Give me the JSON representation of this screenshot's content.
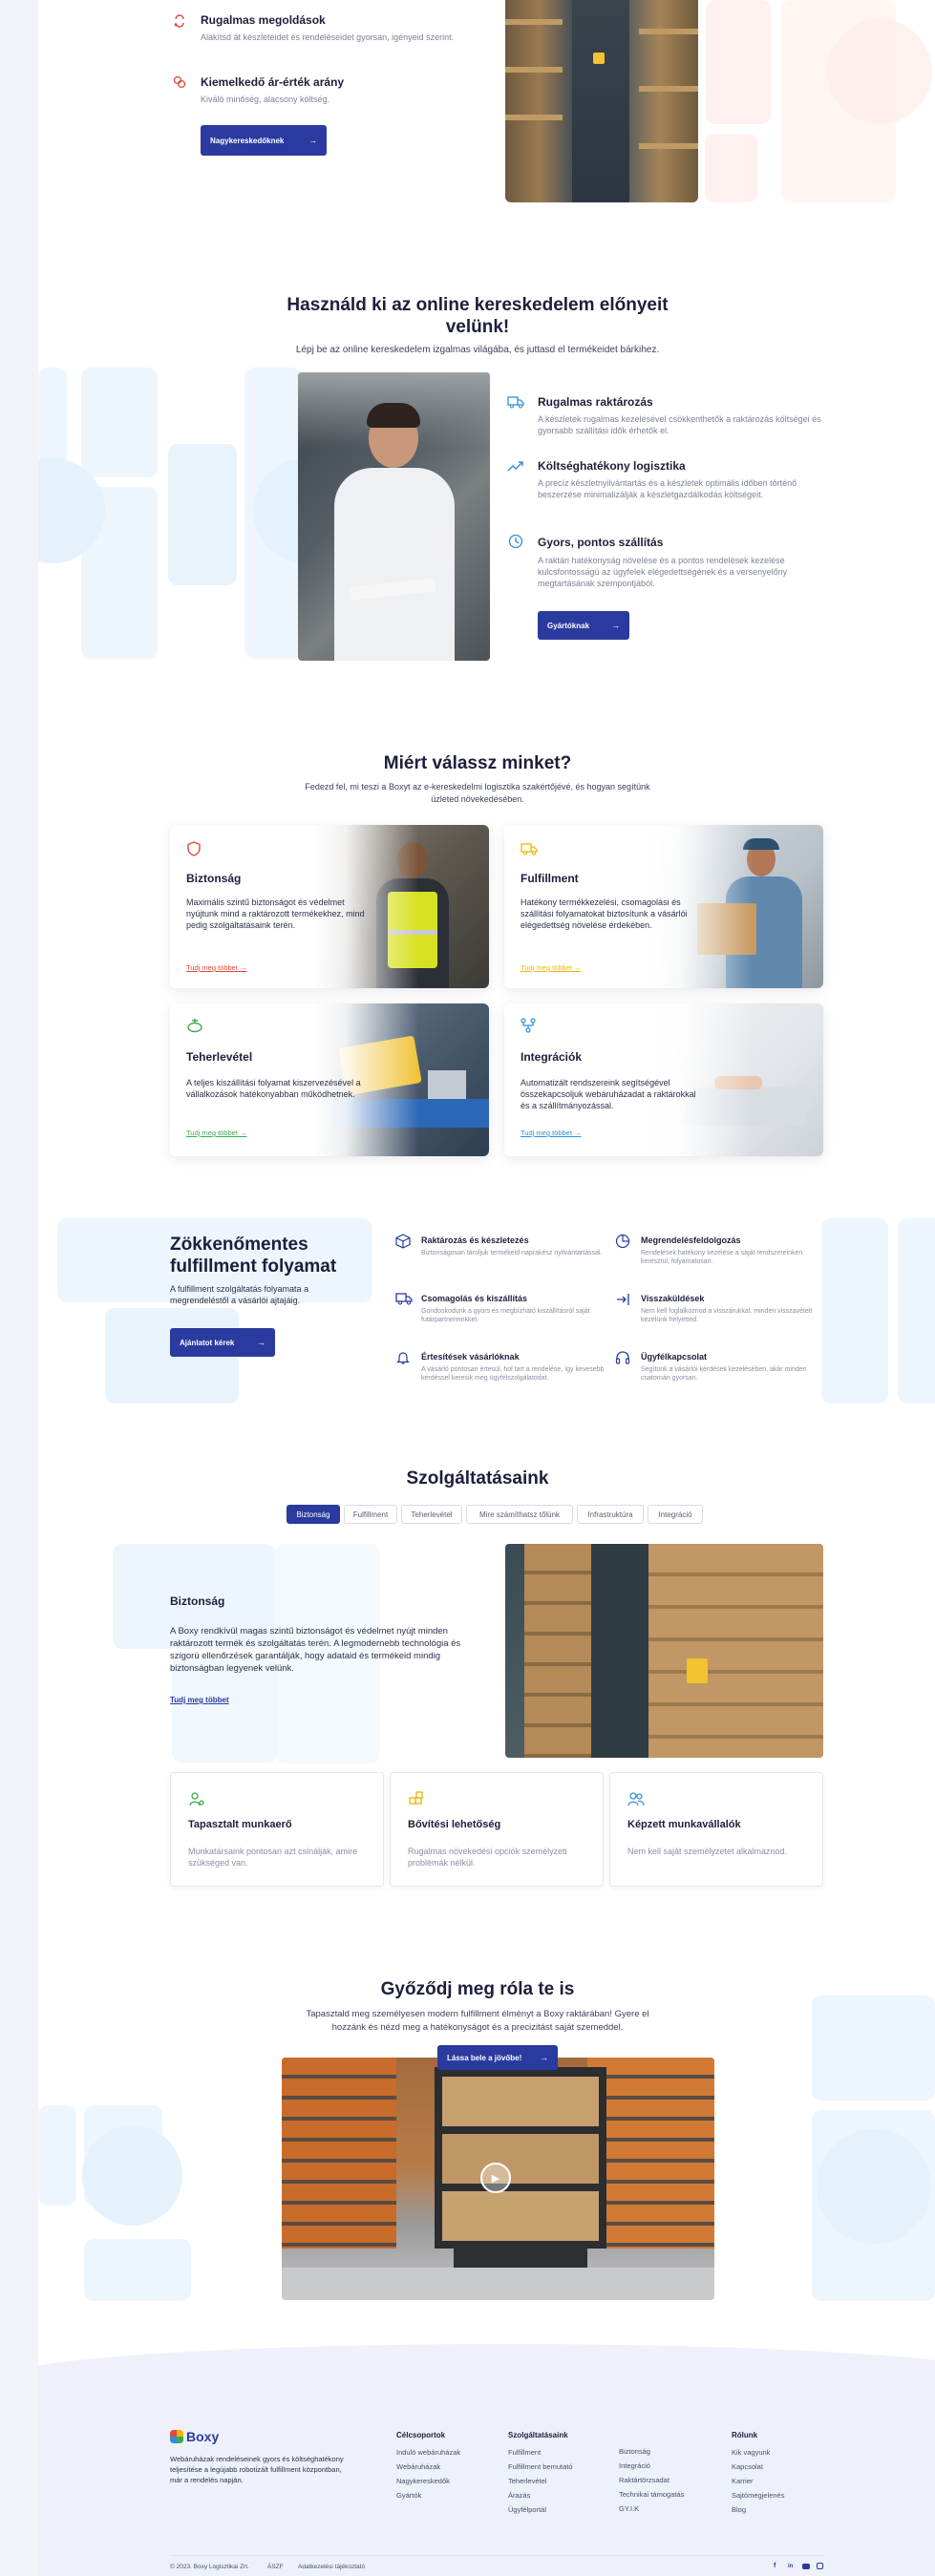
{
  "colors": {
    "brand": "#2a3a9e",
    "accent_red": "#e0473a",
    "accent_blue": "#2f8fd6",
    "accent_yellow": "#f4b400",
    "accent_green": "#3cab4a"
  },
  "top_features": [
    {
      "title": "Rugalmas megoldások",
      "desc": "Alakítsd át készleteidet és rendeléseidet gyorsan, igényeid szerint.",
      "icon": "cycle-icon"
    },
    {
      "title": "Kiemelkedő ár-érték arány",
      "desc": "Kiváló minőség, alacsony költség.",
      "icon": "coins-icon"
    }
  ],
  "top_button": "Nagykereskedőknek",
  "online": {
    "title_line1": "Használd ki az online kereskedelem előnyeit",
    "title_line2": "velünk!",
    "subtitle": "Lépj be az online kereskedelem izgalmas világába, és juttasd el termékeidet bárkihez.",
    "features": [
      {
        "title": "Rugalmas raktározás",
        "desc": "A készletek rugalmas kezelésével csökkenthetők a raktározás költségei és gyorsabb szállítási idők érhetők el.",
        "icon": "truck-icon"
      },
      {
        "title": "Költséghatékony logisztika",
        "desc": "A precíz készletnyilvántartás és a készletek optimális időben történő beszerzése minimalizálják a készletgazdálkodás költségeit.",
        "icon": "trend-up-icon"
      },
      {
        "title": "Gyors, pontos szállítás",
        "desc": "A raktári hatékonyság növelése és a pontos rendelések kezelése kulcsfontosságú az ügyfelek elégedettségének és a versenyelőny megtartásának szempontjából.",
        "icon": "clock-icon"
      }
    ],
    "button": "Gyártóknak"
  },
  "why": {
    "title": "Miért válassz minket?",
    "subtitle_line1": "Fedezd fel, mi teszi a Boxyt az e-kereskedelmi logisztika szakértőjévé, és hogyan segítünk",
    "subtitle_line2": "üzleted növekedésében.",
    "cards": [
      {
        "title": "Biztonság",
        "text": "Maximális szintű biztonságot és védelmet nyújtunk mind a raktározott termékekhez, mind pedig szolgáltatásaink terén.",
        "link": "Tudj meg többet",
        "icon": "shield-icon",
        "color": "#e0473a"
      },
      {
        "title": "Fulfillment",
        "text": "Hatékony termékkezelési, csomagolási és szállítási folyamatokat biztosítunk a vásárlói elégedettség növelése érdekében.",
        "link": "Tudj meg többet",
        "icon": "truck-icon",
        "color": "#f4b400"
      },
      {
        "title": "Teherlevétel",
        "text": "A teljes kiszállítási folyamat kiszervezésével a vállalkozások hatékonyabban működhetnek.",
        "link": "Tudj meg többet",
        "icon": "robot-icon",
        "color": "#3cab4a"
      },
      {
        "title": "Integrációk",
        "text": "Automatizált rendszereink segítségével összekapcsoljuk webáruházadat a raktárokkal és a szállítmányozással.",
        "link": "Tudj meg többet",
        "icon": "nodes-icon",
        "color": "#2f8fd6"
      }
    ]
  },
  "process": {
    "title_line1": "Zökkenőmentes",
    "title_line2": "fulfillment folyamat",
    "desc": "A fulfillment szolgáltatás folyamata a megrendeléstől a vásárlói ajtajáig.",
    "button": "Ajánlatot kérek",
    "items": [
      {
        "title": "Raktározás és készletezés",
        "desc": "Biztonságosan tároljuk termékeid naprakész nyilvántartással.",
        "icon": "box-icon"
      },
      {
        "title": "Megrendelésfeldolgozás",
        "desc": "Rendelések hatékony kezelése a saját rendszereinken keresztül, folyamatosan.",
        "icon": "pie-icon"
      },
      {
        "title": "Csomagolás és kiszállítás",
        "desc": "Gondoskodunk a gyors és megbízható kiszállításról saját futárpartnereinkkel.",
        "icon": "truck-icon"
      },
      {
        "title": "Visszaküldések",
        "desc": "Nem kell foglalkoznod a visszárukkal, minden visszavételt kezelünk helyetted.",
        "icon": "return-icon"
      },
      {
        "title": "Értesítések vásárlóknak",
        "desc": "A vásárló pontosan értesül, hol tart a rendelése, így kevesebb kérdéssel keresik meg ügyfélszolgálatodat.",
        "icon": "bell-icon"
      },
      {
        "title": "Ügyfélkapcsolat",
        "desc": "Segítünk a vásárlói kérdések kezelésében, akár minden csatornán gyorsan.",
        "icon": "headset-icon"
      }
    ]
  },
  "services": {
    "title": "Szolgáltatásaink",
    "tabs": [
      "Biztonság",
      "Fulfillment",
      "Teherlevétel",
      "Mire számíthatsz tőlünk",
      "Infrastruktúra",
      "Integráció"
    ],
    "active_tab": "Biztonság",
    "panel_title": "Biztonság",
    "panel_text": "A Boxy rendkívül magas szintű biztonságot és védelmet nyújt minden raktározott termék és szolgáltatás terén. A legmodernebb technológia és szigorú ellenőrzések garantálják, hogy adataid és termékeid mindig biztonságban legyenek velünk.",
    "panel_link": "Tudj meg többet",
    "minis": [
      {
        "title": "Tapasztalt munkaerő",
        "desc": "Munkatársaink pontosan azt csinálják, amire szükséged van.",
        "icon": "user-gear-icon",
        "color": "#3cab4a"
      },
      {
        "title": "Bővítési lehetőség",
        "desc": "Rugalmas növekedési opciók személyzeti problémák nélkül.",
        "icon": "blocks-icon",
        "color": "#f4b400"
      },
      {
        "title": "Képzett munkavállalók",
        "desc": "Nem kell saját személyzetet alkalmaznod.",
        "icon": "users-icon",
        "color": "#2f8fd6"
      }
    ]
  },
  "video": {
    "title": "Győződj meg róla te is",
    "subtitle_line1": "Tapasztald meg személyesen modern fulfillment élményt a Boxy raktárában! Gyere el",
    "subtitle_line2": "hozzánk és nézd meg a hatékonyságot és a precizitást saját szemeddel.",
    "button": "Lássa bele a jövőbe!"
  },
  "footer": {
    "logo": "Boxy",
    "about": "Webáruházak rendeléseinek gyors és költséghatékony teljesítése a legújabb robotizált fulfillment központban, már a rendelés napján.",
    "columns": [
      {
        "heading": "Célcsoportok",
        "links": [
          "Induló webáruházak",
          "Webáruházak",
          "Nagykereskedők",
          "Gyártók"
        ]
      },
      {
        "heading": "Szolgáltatásaink",
        "links": [
          "Fulfillment",
          "Fulfillment bemutató",
          "Teherlevétel",
          "Árazás",
          "Ügyfélportál"
        ]
      },
      {
        "heading": "",
        "links": [
          "Biztonság",
          "Integráció",
          "Raktártörzsadat",
          "Technikai támogatás",
          "GY.I.K"
        ]
      },
      {
        "heading": "Rólunk",
        "links": [
          "Kik vagyunk",
          "Kapcsolat",
          "Karrier",
          "Sajtómegjelenés",
          "Blog"
        ]
      }
    ],
    "copyright": "© 2023. Boxy Logisztikai Zrt.",
    "aszf": "ÁSZF",
    "privacy": "Adatkezelési tájékoztató"
  }
}
